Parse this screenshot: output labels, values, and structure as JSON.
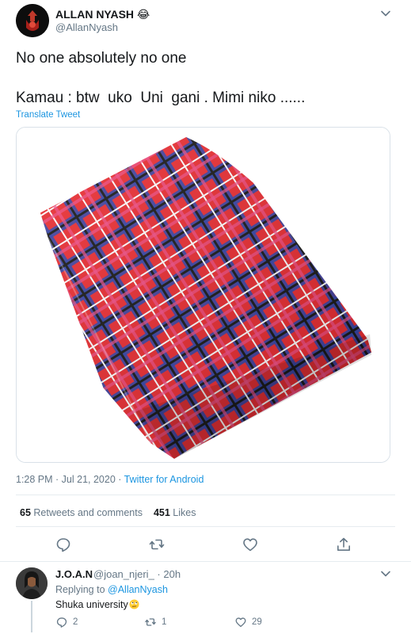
{
  "tweet": {
    "author_name": "ALLAN NYASH 😂",
    "author_handle": "@AllanNyash",
    "text_line1": "No one absolutely no one",
    "text_line2": "Kamau : btw  uko  Uni  gani . Mimi niko ......",
    "translate_label": "Translate Tweet",
    "time": "1:28 PM · Jul 21, 2020 · ",
    "source": "Twitter for Android",
    "retweets_count": "65",
    "retweets_label": "Retweets and comments",
    "likes_count": "451",
    "likes_label": "Likes",
    "icons": [
      "caret-down-icon",
      "reply-icon",
      "retweet-icon",
      "like-icon",
      "share-icon"
    ]
  },
  "reply": {
    "author_name": "J.O.A.N",
    "author_handle": "@joan_njeri_ · 20h",
    "replying_prefix": "Replying to ",
    "replying_mention": "@AllanNyash",
    "text": "Shuka university",
    "reply_count": "2",
    "retweet_count": "1",
    "like_count": "29"
  },
  "colors": {
    "link": "#1b95e0",
    "muted": "#657786",
    "text": "#14171a",
    "border": "#e6ecf0",
    "shuka_red": "#e8262b",
    "shuka_blue": "#2b3fa8"
  }
}
